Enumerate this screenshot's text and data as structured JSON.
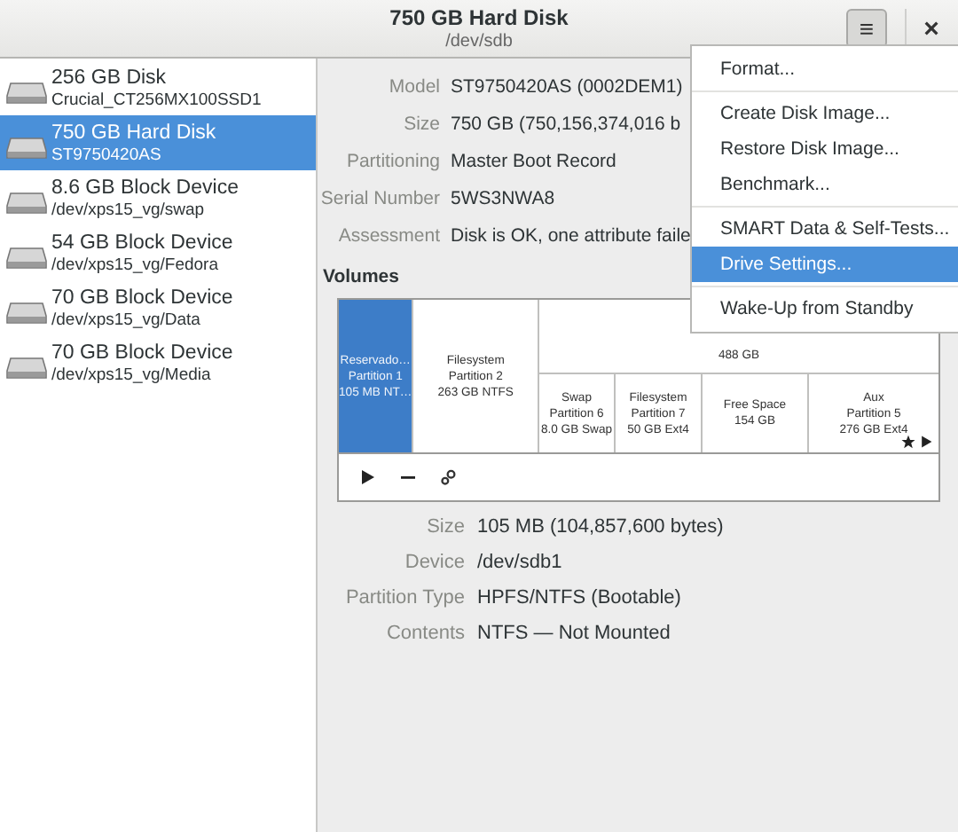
{
  "window": {
    "title": "750 GB Hard Disk",
    "subtitle": "/dev/sdb",
    "menu_button": "≡",
    "close": "×"
  },
  "drives": [
    {
      "name": "256 GB Disk",
      "detail": "Crucial_CT256MX100SSD1",
      "selected": false
    },
    {
      "name": "750 GB Hard Disk",
      "detail": "ST9750420AS",
      "selected": true
    },
    {
      "name": "8.6 GB Block Device",
      "detail": "/dev/xps15_vg/swap",
      "selected": false
    },
    {
      "name": "54 GB Block Device",
      "detail": "/dev/xps15_vg/Fedora",
      "selected": false
    },
    {
      "name": "70 GB Block Device",
      "detail": "/dev/xps15_vg/Data",
      "selected": false
    },
    {
      "name": "70 GB Block Device",
      "detail": "/dev/xps15_vg/Media",
      "selected": false
    }
  ],
  "disk_info": [
    {
      "label": "Model",
      "value": "ST9750420AS (0002DEM1)"
    },
    {
      "label": "Size",
      "value": "750 GB (750,156,374,016 b"
    },
    {
      "label": "Partitioning",
      "value": "Master Boot Record"
    },
    {
      "label": "Serial Number",
      "value": "5WS3NWA8"
    },
    {
      "label": "Assessment",
      "value": "Disk is OK, one attribute faile"
    }
  ],
  "volumes_heading": "Volumes",
  "volumes": [
    {
      "lines": [
        "Reservado…",
        "Partition 1",
        "105 MB NT…"
      ],
      "selected": true,
      "marked": false
    },
    {
      "lines": [
        "Filesystem",
        "Partition 2",
        "263 GB NTFS"
      ],
      "selected": false,
      "marked": false
    },
    {
      "lines": [
        "488 GB"
      ],
      "selected": false,
      "children": [
        {
          "lines": [
            "Swap",
            "Partition 6",
            "8.0 GB Swap"
          ],
          "selected": false,
          "marked": false
        },
        {
          "lines": [
            "Filesystem",
            "Partition 7",
            "50 GB Ext4"
          ],
          "selected": false,
          "marked": false
        },
        {
          "lines": [
            "Free Space",
            "154 GB"
          ],
          "selected": false,
          "marked": false
        },
        {
          "lines": [
            "Aux",
            "Partition 5",
            "276 GB Ext4"
          ],
          "selected": false,
          "marked": true
        }
      ]
    }
  ],
  "partition_info": [
    {
      "label": "Size",
      "value": "105 MB (104,857,600 bytes)"
    },
    {
      "label": "Device",
      "value": "/dev/sdb1"
    },
    {
      "label": "Partition Type",
      "value": "HPFS/NTFS (Bootable)"
    },
    {
      "label": "Contents",
      "value": "NTFS — Not Mounted"
    }
  ],
  "menu": {
    "sections": [
      [
        {
          "label": "Format...",
          "selected": false
        }
      ],
      [
        {
          "label": "Create Disk Image...",
          "selected": false
        },
        {
          "label": "Restore Disk Image...",
          "selected": false
        },
        {
          "label": "Benchmark...",
          "selected": false
        }
      ],
      [
        {
          "label": "SMART Data & Self-Tests...",
          "selected": false
        },
        {
          "label": "Drive Settings...",
          "selected": true
        }
      ],
      [
        {
          "label": "Wake-Up from Standby",
          "selected": false
        }
      ]
    ]
  }
}
